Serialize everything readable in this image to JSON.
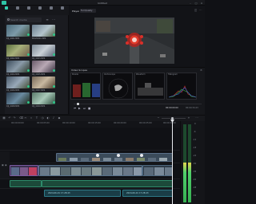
{
  "app": {
    "title": "Wondershare Filmora",
    "window_title": "Untitled",
    "accent": "#2ec4a6"
  },
  "media_tabs": [
    {
      "label": "Media",
      "icon": "media-icon"
    },
    {
      "label": "Stock Media",
      "icon": "stock-icon"
    },
    {
      "label": "Audio",
      "icon": "audio-icon"
    },
    {
      "label": "Titles",
      "icon": "titles-icon"
    },
    {
      "label": "Transitions",
      "icon": "transitions-icon"
    },
    {
      "label": "Templates",
      "icon": "templates-icon"
    }
  ],
  "media": {
    "search_placeholder": "Search media",
    "items": [
      {
        "caption": "DJI_0001.MP4"
      },
      {
        "caption": "MOV0001.MP4"
      },
      {
        "caption": "DJI_0002.MP4"
      },
      {
        "caption": "DJI_0003.MP4"
      },
      {
        "caption": "DJI_0004.MP4"
      },
      {
        "caption": "DJI_0005.MP4"
      },
      {
        "caption": "DJI_0006.MP4"
      },
      {
        "caption": "DJI_0007.MP4"
      },
      {
        "caption": "DJI_0008.MP4"
      },
      {
        "caption": "DJI_0009.MP4"
      }
    ]
  },
  "player": {
    "tab": "Player",
    "quality": "Full Quality",
    "timecode": "00:00:00:00",
    "duration": "00:00:34:23"
  },
  "scopes": {
    "title": "Video Scopes",
    "panels": [
      "Parade",
      "Vectorscope",
      "Waveform",
      "Histogram"
    ]
  },
  "ruler": {
    "marks": [
      "00:00:00:00",
      "00:00:05:00",
      "00:00:10:00",
      "00:00:15:00",
      "00:00:20:00",
      "00:00:25:00",
      "00:00:30:00"
    ]
  },
  "timeline": {
    "audio_clip_1": "2024-06-01 17:28:43",
    "audio_clip_2": "2024-06-01 17:28:43"
  },
  "meter": {
    "labels": [
      "0",
      "-6",
      "-12",
      "-18",
      "-24",
      "-30",
      "-36",
      "-42",
      "-48",
      "-54"
    ]
  }
}
